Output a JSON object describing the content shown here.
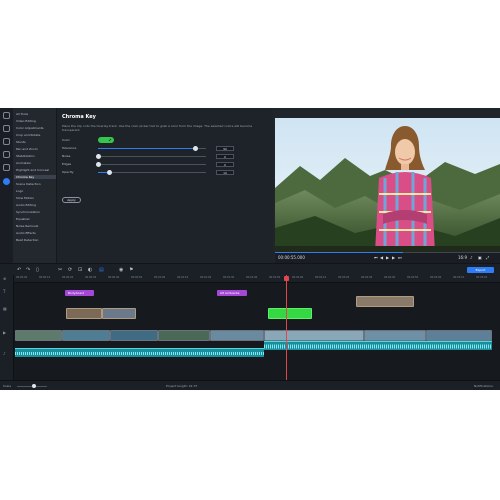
{
  "tools": {
    "header": "All Tools",
    "items": [
      {
        "label": "Video Editing",
        "selected": false
      },
      {
        "label": "Color Adjustments",
        "selected": false
      },
      {
        "label": "Crop and Rotate",
        "selected": false
      },
      {
        "label": "Stunts",
        "selected": false
      },
      {
        "label": "Pan and Zoom",
        "selected": false
      },
      {
        "label": "Stabilization",
        "selected": false
      },
      {
        "label": "Animation",
        "selected": false
      },
      {
        "label": "Highlight and Conceal",
        "selected": false
      },
      {
        "label": "Chroma Key",
        "selected": true
      },
      {
        "label": "Scene Detection",
        "selected": false
      },
      {
        "label": "Logo",
        "selected": false
      },
      {
        "label": "Slow Motion",
        "selected": false
      },
      {
        "label": "Audio Editing",
        "selected": false
      },
      {
        "label": "Synchronization",
        "selected": false
      },
      {
        "label": "Equalizer",
        "selected": false
      },
      {
        "label": "Noise Removal",
        "selected": false
      },
      {
        "label": "Audio Effects",
        "selected": false
      },
      {
        "label": "Beat Detection",
        "selected": false
      }
    ]
  },
  "settings": {
    "title": "Chroma Key",
    "description": "Place the clip onto the Overlay track. Use the color picker tool to grab a color from the image. The selected colors will become transparent.",
    "color_label": "Color",
    "color_value": "#36c64c",
    "params": [
      {
        "label": "Tolerance",
        "value": "90",
        "fraction": 0.9
      },
      {
        "label": "Noise",
        "value": "0",
        "fraction": 0.0
      },
      {
        "label": "Edges",
        "value": "0",
        "fraction": 0.0
      },
      {
        "label": "Opacity",
        "value": "10",
        "fraction": 0.1
      }
    ],
    "apply_label": "Apply"
  },
  "player": {
    "time": "00:00:55.000",
    "zoom": "16:9",
    "progress_fraction": 0.57
  },
  "toolbar": {
    "export_label": "Export"
  },
  "timeline": {
    "ruler_ticks": [
      "00:00:00",
      "00:00:10",
      "00:00:20",
      "00:00:30",
      "00:00:40",
      "00:00:50",
      "00:01:00",
      "00:01:10",
      "00:01:20",
      "00:01:30",
      "00:01:40",
      "00:01:50",
      "00:02:00",
      "00:02:10",
      "00:02:20",
      "00:02:30",
      "00:02:40",
      "00:02:50",
      "00:03:00",
      "00:03:10",
      "00:03:20"
    ],
    "title_clips": [
      {
        "label": "Bodyboard"
      },
      {
        "label": "Alt Ambiente"
      }
    ]
  },
  "status": {
    "scale_label": "Scale",
    "project_length": "Project length: 01:37",
    "notifications_label": "Notifications"
  },
  "colors": {
    "accent": "#2f7df6",
    "chroma_green": "#35d743",
    "title_clip": "#a548d6",
    "audio": "#1c8d9a",
    "playhead": "#e0474c"
  }
}
